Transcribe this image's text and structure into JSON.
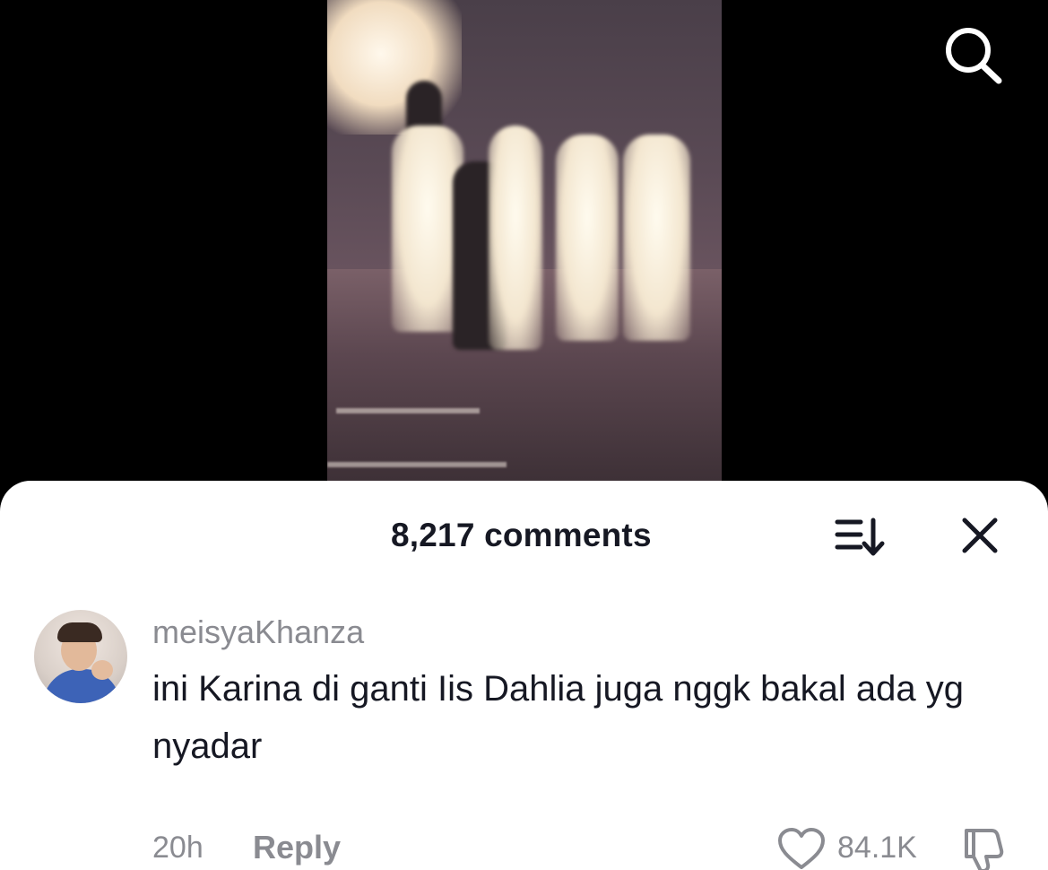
{
  "header": {
    "comment_count": "8,217 comments"
  },
  "comments": [
    {
      "username": "meisyaKhanza",
      "text": "ini Karina di ganti Iis Dahlia juga nggk bakal ada yg nyadar",
      "timestamp": "20h",
      "reply_label": "Reply",
      "likes": "84.1K"
    }
  ],
  "icons": {
    "search": "search-icon",
    "sort": "sort-icon",
    "close": "close-icon",
    "like": "heart-icon",
    "dislike": "thumbs-down-icon"
  },
  "colors": {
    "text_primary": "#161823",
    "text_secondary": "#8a8b91",
    "sheet_background": "#ffffff",
    "screen_background": "#000000"
  }
}
